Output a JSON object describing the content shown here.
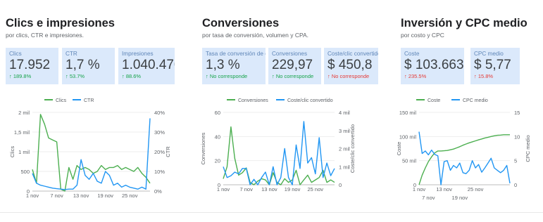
{
  "panels": [
    {
      "title": "Clics e impresiones",
      "subtitle": "por clics, CTR e impresiones.",
      "cards": [
        {
          "label": "Clics",
          "value": "17.952",
          "change": "↑ 189.8%",
          "trend": "up"
        },
        {
          "label": "CTR",
          "value": "1,7 %",
          "change": "↑ 53.7%",
          "trend": "up"
        },
        {
          "label": "Impresiones",
          "value": "1.040.470",
          "change": "↑ 88.6%",
          "trend": "up"
        }
      ]
    },
    {
      "title": "Conversiones",
      "subtitle": "por tasa de conversión, volumen y CPA.",
      "cards": [
        {
          "label": "Tasa de conversión de clics",
          "value": "1,3 %",
          "change": "↑ No corresponde",
          "trend": "up"
        },
        {
          "label": "Conversiones",
          "value": "229,97",
          "change": "↑ No corresponde",
          "trend": "up"
        },
        {
          "label": "Coste/clic convertido",
          "value": "$ 450,8",
          "change": "↑ No corresponde",
          "trend": "down"
        }
      ]
    },
    {
      "title": "Inversión y CPC medio",
      "subtitle": "por costo y CPC",
      "cards": [
        {
          "label": "Coste",
          "value": "$ 103.663",
          "change": "↑ 235.5%",
          "trend": "down"
        },
        {
          "label": "CPC medio",
          "value": "$ 5,77",
          "change": "↑ 15.8%",
          "trend": "down"
        }
      ]
    }
  ],
  "chart_data": [
    {
      "type": "line",
      "legend_position": "top",
      "x": [
        1,
        2,
        3,
        4,
        5,
        6,
        7,
        8,
        9,
        10,
        11,
        12,
        13,
        14,
        15,
        16,
        17,
        18,
        19,
        20,
        21,
        22,
        23,
        24,
        25,
        26,
        27,
        28,
        29,
        30
      ],
      "x_ticks": [
        {
          "x": 1,
          "label": "1 nov"
        },
        {
          "x": 7,
          "label": "7 nov"
        },
        {
          "x": 13,
          "label": "13 nov"
        },
        {
          "x": 19,
          "label": "19 nov"
        },
        {
          "x": 25,
          "label": "25 nov"
        }
      ],
      "ylabel": "Clics",
      "ylim": [
        0,
        2000
      ],
      "y_ticks": [
        {
          "v": 0,
          "label": "0"
        },
        {
          "v": 500,
          "label": "500"
        },
        {
          "v": 1000,
          "label": "1 mil"
        },
        {
          "v": 1500,
          "label": "1,5 mil"
        },
        {
          "v": 2000,
          "label": "2 mil"
        }
      ],
      "y2label": "CTR",
      "y2lim": [
        0,
        40
      ],
      "y2_ticks": [
        {
          "v": 0,
          "label": "0%"
        },
        {
          "v": 10,
          "label": "10%"
        },
        {
          "v": 20,
          "label": "20%"
        },
        {
          "v": 30,
          "label": "30%"
        },
        {
          "v": 40,
          "label": "40%"
        }
      ],
      "series": [
        {
          "name": "Clics",
          "axis": "left",
          "color": "#4caf50",
          "values": [
            550,
            200,
            1950,
            1700,
            1350,
            1300,
            1250,
            50,
            0,
            600,
            300,
            650,
            550,
            600,
            550,
            450,
            500,
            650,
            550,
            600,
            600,
            650,
            550,
            600,
            550,
            500,
            600,
            450,
            350,
            200
          ]
        },
        {
          "name": "CTR",
          "axis": "right",
          "color": "#2196f3",
          "values": [
            9,
            4,
            3,
            2.5,
            2,
            1.5,
            1.2,
            1,
            0.8,
            1,
            1,
            3,
            16,
            8,
            6,
            9,
            5,
            4,
            10,
            8,
            3,
            4,
            2,
            3,
            2,
            1.5,
            1,
            2,
            1,
            37
          ]
        }
      ]
    },
    {
      "type": "line",
      "legend_position": "top",
      "x": [
        1,
        2,
        3,
        4,
        5,
        6,
        7,
        8,
        9,
        10,
        11,
        12,
        13,
        14,
        15,
        16,
        17,
        18,
        19,
        20,
        21,
        22,
        23,
        24,
        25,
        26,
        27,
        28,
        29,
        30
      ],
      "x_ticks": [
        {
          "x": 1,
          "label": "1 nov"
        },
        {
          "x": 7,
          "label": "7 nov"
        },
        {
          "x": 13,
          "label": "13 nov"
        },
        {
          "x": 19,
          "label": "19 nov"
        },
        {
          "x": 25,
          "label": "25 nov"
        }
      ],
      "ylabel": "Conversiones",
      "ylim": [
        0,
        60
      ],
      "y_ticks": [
        {
          "v": 0,
          "label": "0"
        },
        {
          "v": 20,
          "label": "20"
        },
        {
          "v": 40,
          "label": "40"
        },
        {
          "v": 60,
          "label": "60"
        }
      ],
      "y2label": "Coste/clic convertido",
      "y2lim": [
        0,
        4000
      ],
      "y2_ticks": [
        {
          "v": 0,
          "label": "0"
        },
        {
          "v": 1000,
          "label": "1 mil"
        },
        {
          "v": 2000,
          "label": "2 mil"
        },
        {
          "v": 3000,
          "label": "3 mil"
        },
        {
          "v": 4000,
          "label": "4 mil"
        }
      ],
      "series": [
        {
          "name": "Conversiones",
          "axis": "left",
          "color": "#4caf50",
          "values": [
            5,
            15,
            48,
            22,
            8,
            10,
            14,
            2,
            0,
            3,
            5,
            4,
            0,
            10,
            2,
            0,
            5,
            2,
            4,
            12,
            0,
            4,
            8,
            2,
            4,
            6,
            12,
            2,
            4,
            2
          ]
        },
        {
          "name": "Coste/clic convertido",
          "axis": "right",
          "color": "#2196f3",
          "values": [
            1000,
            400,
            500,
            700,
            600,
            900,
            900,
            0,
            300,
            0,
            400,
            700,
            0,
            1000,
            0,
            400,
            2000,
            400,
            0,
            2200,
            900,
            3500,
            1200,
            1500,
            600,
            2600,
            400,
            1200,
            500,
            900
          ]
        }
      ]
    },
    {
      "type": "line",
      "legend_position": "top",
      "x": [
        1,
        2,
        3,
        4,
        5,
        6,
        7,
        8,
        9,
        10,
        11,
        12,
        13,
        14,
        15,
        16,
        17,
        18,
        19,
        20,
        21,
        22,
        23,
        24,
        25,
        26,
        27,
        28,
        29,
        30
      ],
      "x_ticks": [
        {
          "x": 1,
          "label": "1 nov",
          "row": 1
        },
        {
          "x": 4,
          "label": "7 nov",
          "row": 2
        },
        {
          "x": 9,
          "label": "13 nov",
          "row": 1
        },
        {
          "x": 14,
          "label": "19 nov",
          "row": 2
        },
        {
          "x": 19,
          "label": "25 nov",
          "row": 1
        }
      ],
      "ylabel": "Coste",
      "ylim": [
        0,
        150000
      ],
      "y_ticks": [
        {
          "v": 0,
          "label": "0"
        },
        {
          "v": 50000,
          "label": "50 mil"
        },
        {
          "v": 100000,
          "label": "100 mil"
        },
        {
          "v": 150000,
          "label": "150 mil"
        }
      ],
      "y2label": "CPC medio",
      "y2lim": [
        0,
        15
      ],
      "y2_ticks": [
        {
          "v": 0,
          "label": "0"
        },
        {
          "v": 5,
          "label": "5"
        },
        {
          "v": 10,
          "label": "10"
        },
        {
          "v": 15,
          "label": "15"
        }
      ],
      "series": [
        {
          "name": "Coste",
          "axis": "left",
          "color": "#4caf50",
          "values": [
            0,
            20000,
            35000,
            48000,
            58000,
            66000,
            70000,
            70000,
            70500,
            71000,
            72500,
            74000,
            76500,
            79000,
            82000,
            84500,
            87000,
            89000,
            91000,
            93000,
            95000,
            97000,
            98500,
            100000,
            101500,
            102500,
            103000,
            103663,
            103663,
            103663
          ]
        },
        {
          "name": "CPC medio",
          "axis": "right",
          "color": "#2196f3",
          "values": [
            11,
            6.5,
            7,
            6.2,
            7.2,
            6.3,
            6,
            0,
            4.8,
            5,
            3,
            4,
            3.5,
            4.5,
            2.5,
            2.3,
            3,
            5,
            3.5,
            4.2,
            2.6,
            3.5,
            4.5,
            5.5,
            3.5,
            3,
            2.5,
            3,
            4,
            0.3
          ]
        }
      ]
    }
  ]
}
